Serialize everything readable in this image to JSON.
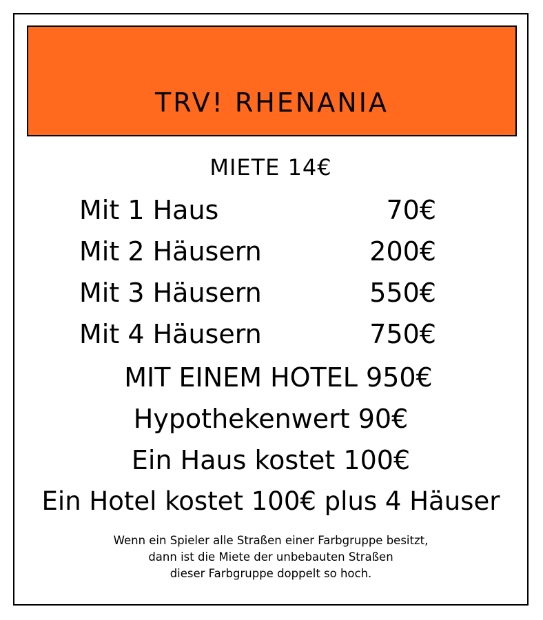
{
  "card": {
    "title": "TRV! RHENANIA",
    "title_color": "#FF6A1F",
    "rent": "MIETE 14€",
    "houses": [
      {
        "label": "Mit 1 Haus",
        "price": "70€"
      },
      {
        "label": "Mit 2 Häusern",
        "price": "200€"
      },
      {
        "label": "Mit 3 Häusern",
        "price": "550€"
      },
      {
        "label": "Mit 4 Häusern",
        "price": "750€"
      }
    ],
    "hotel": "MIT EINEM HOTEL 950€",
    "mortgage": "Hypothekenwert 90€",
    "house_cost": "Ein Haus kostet 100€",
    "hotel_cost": "Ein Hotel kostet 100€ plus 4 Häuser",
    "notice": [
      "Wenn ein Spieler alle Straßen einer Farbgruppe besitzt,",
      "dann ist die Miete der unbebauten Straßen",
      "dieser Farbgruppe doppelt so hoch."
    ]
  }
}
